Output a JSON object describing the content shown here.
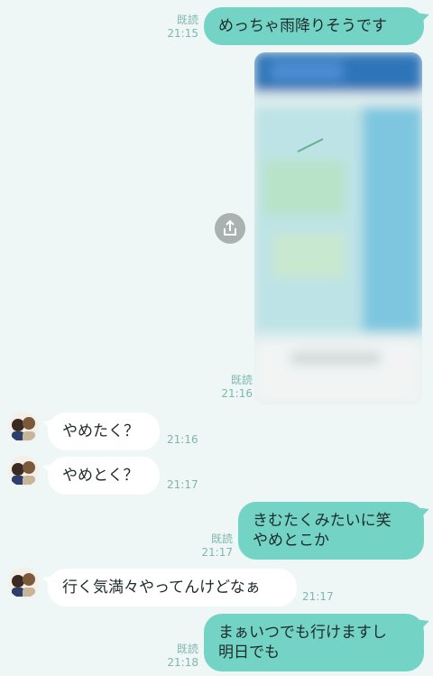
{
  "messages": [
    {
      "dir": "out",
      "read": "既読",
      "time": "21:15",
      "lines": [
        "めっちゃ雨降りそうです"
      ]
    },
    {
      "dir": "out",
      "type": "image",
      "read": "既読",
      "time": "21:16",
      "image_label": "blurred-map-screenshot"
    },
    {
      "dir": "in",
      "time": "21:16",
      "lines": [
        "やめたく？"
      ]
    },
    {
      "dir": "in",
      "time": "21:17",
      "lines": [
        "やめとく？"
      ]
    },
    {
      "dir": "out",
      "read": "既読",
      "time": "21:17",
      "lines": [
        "きむたくみたいに笑",
        "やめとこか"
      ]
    },
    {
      "dir": "in",
      "time": "21:17",
      "lines": [
        "行く気満々やってんけどなぁ"
      ]
    },
    {
      "dir": "out",
      "read": "既読",
      "time": "21:18",
      "lines": [
        "まぁいつでも行けますし",
        "明日でも"
      ]
    }
  ],
  "colors": {
    "background": "#eef7f5",
    "outgoing": "#73d3c5",
    "incoming": "#ffffff",
    "meta": "#7fb6b0"
  },
  "icons": {
    "share": "share-icon",
    "avatar": "contact-avatar"
  }
}
